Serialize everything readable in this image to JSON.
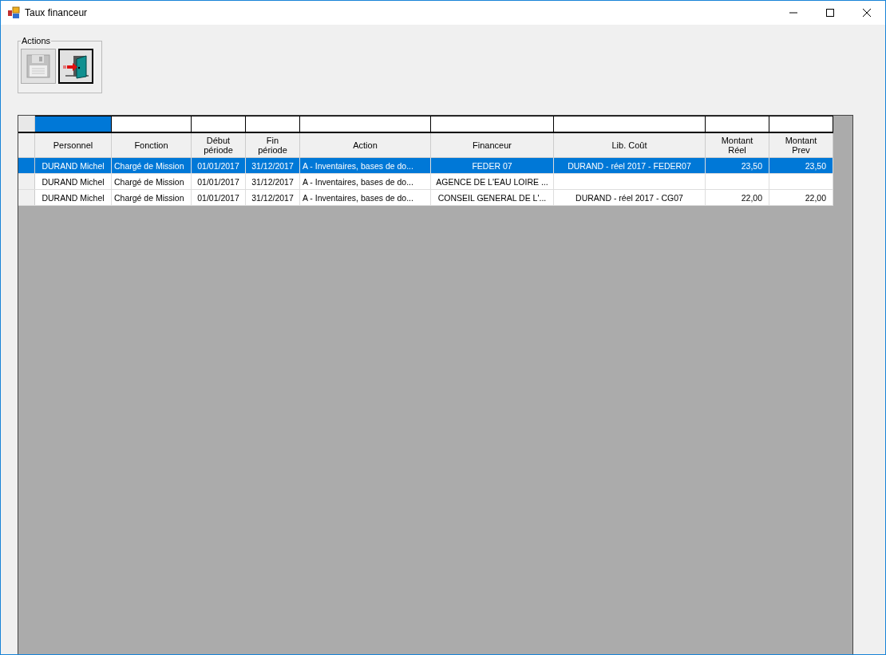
{
  "window": {
    "title": "Taux financeur"
  },
  "actions_group": {
    "label": "Actions",
    "buttons": [
      {
        "kind": "save",
        "disabled": true
      },
      {
        "kind": "exit",
        "disabled": false
      }
    ]
  },
  "filter_row": [
    {
      "selected": true
    },
    {
      "selected": false
    },
    {
      "selected": false
    },
    {
      "selected": false
    },
    {
      "selected": false
    },
    {
      "selected": false
    },
    {
      "selected": false
    },
    {
      "selected": false
    },
    {
      "selected": false
    }
  ],
  "table": {
    "columns": [
      "Personnel",
      "Fonction",
      "Début\npériode",
      "Fin\npériode",
      "Action",
      "Financeur",
      "Lib. Coût",
      "Montant\nRéel",
      "Montant\nPrev"
    ],
    "rows": [
      {
        "selected": true,
        "cells": [
          "DURAND Michel",
          "Chargé de Mission",
          "01/01/2017",
          "31/12/2017",
          "A - Inventaires, bases de do...",
          "FEDER 07",
          "DURAND - réel 2017 - FEDER07",
          "23,50",
          "23,50"
        ]
      },
      {
        "selected": false,
        "cells": [
          "DURAND Michel",
          "Chargé de Mission",
          "01/01/2017",
          "31/12/2017",
          "A - Inventaires, bases de do...",
          "AGENCE DE L'EAU LOIRE ...",
          "",
          "",
          ""
        ]
      },
      {
        "selected": false,
        "cells": [
          "DURAND Michel",
          "Chargé de Mission",
          "01/01/2017",
          "31/12/2017",
          "A - Inventaires, bases de do...",
          "CONSEIL GENERAL DE L'...",
          "DURAND - réel 2017 - CG07",
          "22,00",
          "22,00"
        ]
      }
    ]
  }
}
